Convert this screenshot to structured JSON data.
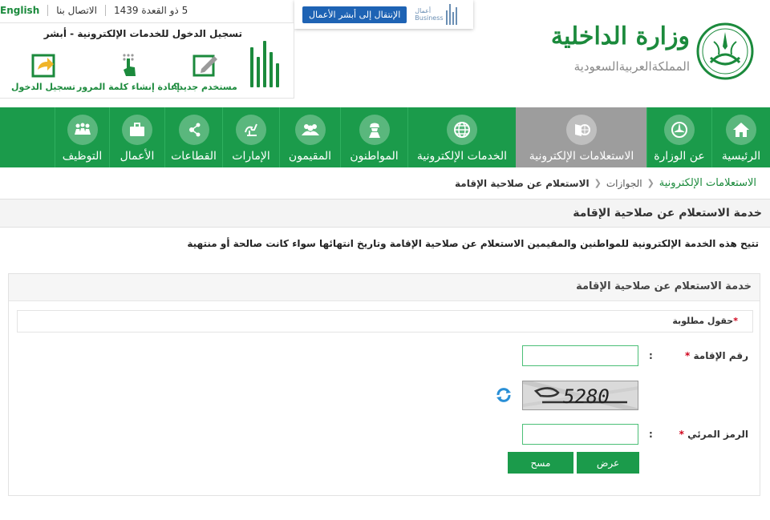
{
  "topbar": {
    "date": "5 ذو القعدة 1439",
    "contact": "الاتصال بنا",
    "language": "English"
  },
  "business": {
    "button": "الإنتقال إلى أبشر الأعمال",
    "logo_ar": "أعمال",
    "logo_en": "Business"
  },
  "login": {
    "title": "تسجيل الدخول للخدمات الإلكترونية - أبشر",
    "actions": [
      {
        "label": "مستخدم جديد؟",
        "icon": "new-user-icon"
      },
      {
        "label": "إعادة إنشاء كلمة المرور",
        "icon": "reset-password-icon"
      },
      {
        "label": "تسجيل الدخول",
        "icon": "login-icon"
      }
    ]
  },
  "ministry": {
    "title": "وزارة الداخلية",
    "subtitle": "المملكةالعربيةالسعودية"
  },
  "nav": {
    "items": [
      {
        "label": "الرئيسية",
        "icon": "home-icon"
      },
      {
        "label": "عن الوزارة",
        "icon": "ministry-emblem-icon"
      },
      {
        "label": "الاستعلامات الإلكترونية",
        "icon": "inquiries-icon",
        "active": true
      },
      {
        "label": "الخدمات الإلكترونية",
        "icon": "globe-icon"
      },
      {
        "label": "المواطنون",
        "icon": "citizen-icon"
      },
      {
        "label": "المقيمون",
        "icon": "residents-icon"
      },
      {
        "label": "الإمارات",
        "icon": "emirates-icon"
      },
      {
        "label": "القطاعات",
        "icon": "sectors-icon"
      },
      {
        "label": "الأعمال",
        "icon": "briefcase-icon"
      },
      {
        "label": "التوظيف",
        "icon": "employment-icon"
      }
    ]
  },
  "breadcrumb": {
    "items": [
      "الاستعلامات الإلكترونية",
      "الجوازات",
      "الاستعلام عن صلاحية الإقامة"
    ]
  },
  "service": {
    "title": "خدمة الاستعلام عن صلاحية الإقامة",
    "description": "تتيح هذه الخدمة الإلكترونية للمواطنين والمقيمين الاستعلام عن صلاحية الإقامة وتاريخ انتهائها سواء كانت صالحة أو منتهية"
  },
  "form": {
    "title": "خدمة الاستعلام عن صلاحية الإقامة",
    "required_note": "حقول مطلوبة",
    "required_mark": "*",
    "iqama_label": "رقم الإقامة",
    "iqama_value": "",
    "captcha_text": "5280",
    "visual_code_label": "الرمز المرئي",
    "visual_code_value": "",
    "colon": ":",
    "submit": "عرض",
    "clear": "مسح"
  },
  "colors": {
    "brand_green": "#1b9b4b",
    "active_tab": "#9d9d9d",
    "link_green": "#1b8a3c",
    "business_blue": "#1e63b4"
  }
}
